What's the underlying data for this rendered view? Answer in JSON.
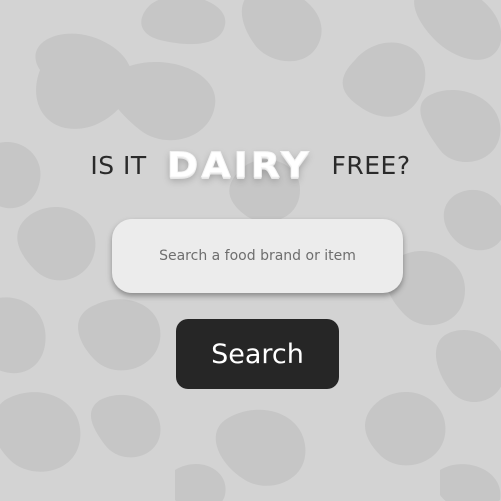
{
  "headline": {
    "prefix": "IS IT",
    "highlight": "DAIRY",
    "suffix": "FREE?"
  },
  "search": {
    "placeholder": "Search a food brand or item",
    "value": ""
  },
  "search_button": {
    "label": "Search"
  },
  "colors": {
    "background": "#d3d3d3",
    "spots": "#c6c6c6",
    "input_background": "#ececec",
    "button_background": "#262626",
    "button_text": "#ffffff",
    "headline_text": "#2a2a2a"
  }
}
